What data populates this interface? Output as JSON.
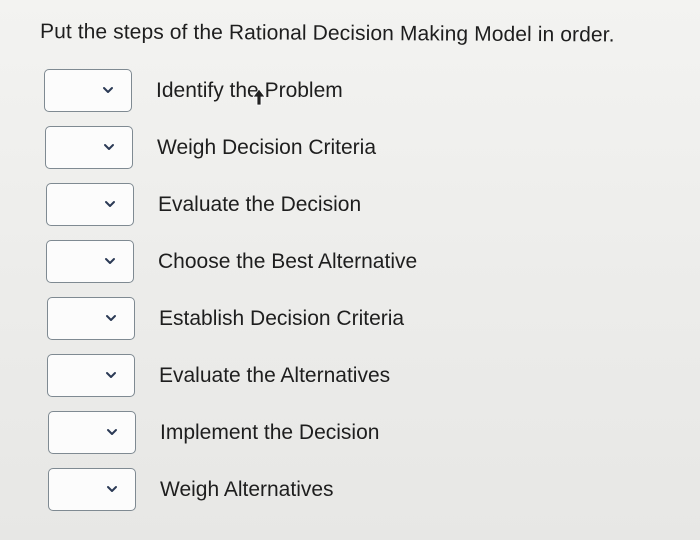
{
  "question": {
    "text": "Put the steps of the Rational Decision Making Model in order."
  },
  "steps": [
    {
      "label": "Identify the Problem",
      "selected": ""
    },
    {
      "label": "Weigh Decision Criteria",
      "selected": ""
    },
    {
      "label": "Evaluate the Decision",
      "selected": ""
    },
    {
      "label": "Choose the Best Alternative",
      "selected": ""
    },
    {
      "label": "Establish Decision Criteria",
      "selected": ""
    },
    {
      "label": "Evaluate the Alternatives",
      "selected": ""
    },
    {
      "label": "Implement the Decision",
      "selected": ""
    },
    {
      "label": "Weigh Alternatives",
      "selected": ""
    }
  ],
  "icons": {
    "dropdown": "chevron-down-icon",
    "pointer": "mouse-pointer-icon"
  },
  "colors": {
    "border": "#7f8a92",
    "text": "#1e1e1e",
    "background": "#efefed"
  }
}
